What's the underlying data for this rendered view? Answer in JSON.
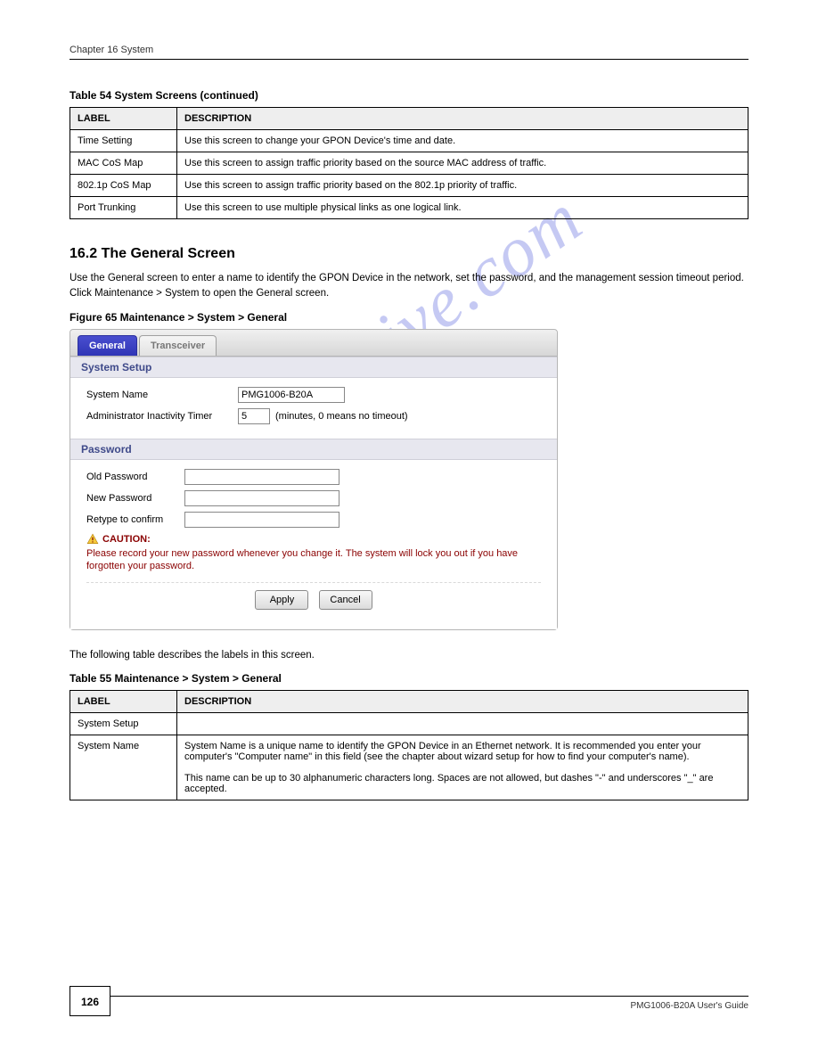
{
  "header": {
    "left": "Chapter 16 System",
    "right": ""
  },
  "table1": {
    "caption": "Table 54   System Screens (continued)",
    "headers": [
      "LABEL",
      "DESCRIPTION"
    ],
    "rows": [
      {
        "label": "Time Setting",
        "desc": "Use this screen to change your GPON Device's time and date."
      },
      {
        "label": "MAC CoS Map",
        "desc": "Use this screen to assign traffic priority based on the source MAC address of traffic."
      },
      {
        "label": "802.1p CoS Map",
        "desc": "Use this screen to assign traffic priority based on the 802.1p priority of traffic."
      },
      {
        "label": "Port Trunking",
        "desc": "Use this screen to use multiple physical links as one logical link."
      }
    ]
  },
  "section_heading": "16.2  The General Screen",
  "section_text1": "Use the General screen to enter a name to identify the GPON Device in the network, set the password, and the management session timeout period. Click Maintenance > System to open the General screen.",
  "figure_caption": "Figure 65   Maintenance > System > General",
  "app": {
    "tabs": {
      "general": "General",
      "transceiver": "Transceiver"
    },
    "group1_title": "System Setup",
    "system_name_label": "System Name",
    "system_name_value": "PMG1006-B20A",
    "timer_label": "Administrator Inactivity Timer",
    "timer_value": "5",
    "timer_hint": "(minutes, 0 means no timeout)",
    "group2_title": "Password",
    "old_pw_label": "Old Password",
    "new_pw_label": "New Password",
    "retype_label": "Retype to confirm",
    "caution": "CAUTION:",
    "caution_msg": "Please record your new password whenever you change it. The system will lock you out if you have forgotten your password.",
    "apply_btn": "Apply",
    "cancel_btn": "Cancel"
  },
  "table2_intro": "The following table describes the labels in this screen.",
  "table2": {
    "caption": "Table 55   Maintenance > System > General",
    "headers": [
      "LABEL",
      "DESCRIPTION"
    ],
    "rows": [
      {
        "label": "System Setup",
        "desc": ""
      },
      {
        "label": "System Name",
        "desc": "System Name is a unique name to identify the GPON Device in an Ethernet network. It is recommended you enter your computer's \"Computer name\" in this field (see the chapter about wizard setup for how to find your computer's name).\n\nThis name can be up to 30 alphanumeric characters long. Spaces are not allowed, but dashes \"-\" and underscores \"_\" are accepted."
      }
    ]
  },
  "page_number": "126",
  "footer_right": "PMG1006-B20A User's Guide",
  "watermark": "manualshive.com"
}
